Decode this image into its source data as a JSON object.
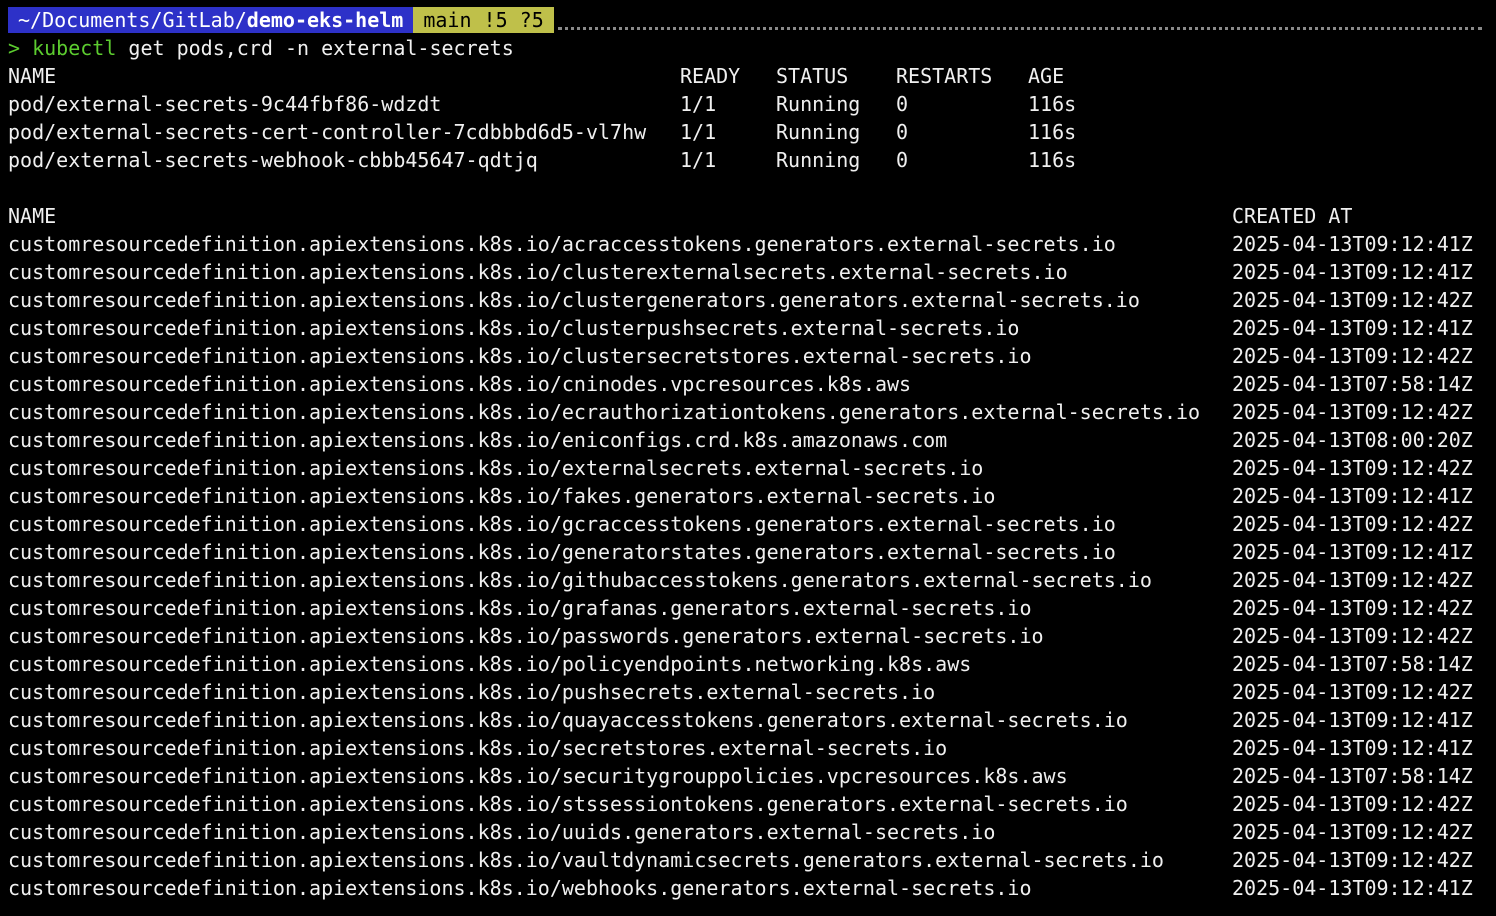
{
  "prompt": {
    "path_prefix": "~/Documents/GitLab/",
    "path_dir": "demo-eks-helm",
    "git_status": "main !5 ?5",
    "symbol": ">",
    "command_name": "kubectl",
    "command_args": " get pods,crd -n external-secrets"
  },
  "colors": {
    "background": "#000000",
    "path_segment": "#2d31c8",
    "git_segment": "#bfc04a",
    "prompt_green": "#5ccc2f",
    "text": "#f0f0f0"
  },
  "pods": {
    "headers": [
      "NAME",
      "READY",
      "STATUS",
      "RESTARTS",
      "AGE"
    ],
    "rows": [
      [
        "pod/external-secrets-9c44fbf86-wdzdt",
        "1/1",
        "Running",
        "0",
        "116s"
      ],
      [
        "pod/external-secrets-cert-controller-7cdbbbd6d5-vl7hw",
        "1/1",
        "Running",
        "0",
        "116s"
      ],
      [
        "pod/external-secrets-webhook-cbbb45647-qdtjq",
        "1/1",
        "Running",
        "0",
        "116s"
      ]
    ]
  },
  "crds": {
    "headers": [
      "NAME",
      "CREATED AT"
    ],
    "rows": [
      [
        "customresourcedefinition.apiextensions.k8s.io/acraccesstokens.generators.external-secrets.io",
        "2025-04-13T09:12:41Z"
      ],
      [
        "customresourcedefinition.apiextensions.k8s.io/clusterexternalsecrets.external-secrets.io",
        "2025-04-13T09:12:41Z"
      ],
      [
        "customresourcedefinition.apiextensions.k8s.io/clustergenerators.generators.external-secrets.io",
        "2025-04-13T09:12:42Z"
      ],
      [
        "customresourcedefinition.apiextensions.k8s.io/clusterpushsecrets.external-secrets.io",
        "2025-04-13T09:12:41Z"
      ],
      [
        "customresourcedefinition.apiextensions.k8s.io/clustersecretstores.external-secrets.io",
        "2025-04-13T09:12:42Z"
      ],
      [
        "customresourcedefinition.apiextensions.k8s.io/cninodes.vpcresources.k8s.aws",
        "2025-04-13T07:58:14Z"
      ],
      [
        "customresourcedefinition.apiextensions.k8s.io/ecrauthorizationtokens.generators.external-secrets.io",
        "2025-04-13T09:12:42Z"
      ],
      [
        "customresourcedefinition.apiextensions.k8s.io/eniconfigs.crd.k8s.amazonaws.com",
        "2025-04-13T08:00:20Z"
      ],
      [
        "customresourcedefinition.apiextensions.k8s.io/externalsecrets.external-secrets.io",
        "2025-04-13T09:12:42Z"
      ],
      [
        "customresourcedefinition.apiextensions.k8s.io/fakes.generators.external-secrets.io",
        "2025-04-13T09:12:41Z"
      ],
      [
        "customresourcedefinition.apiextensions.k8s.io/gcraccesstokens.generators.external-secrets.io",
        "2025-04-13T09:12:42Z"
      ],
      [
        "customresourcedefinition.apiextensions.k8s.io/generatorstates.generators.external-secrets.io",
        "2025-04-13T09:12:41Z"
      ],
      [
        "customresourcedefinition.apiextensions.k8s.io/githubaccesstokens.generators.external-secrets.io",
        "2025-04-13T09:12:42Z"
      ],
      [
        "customresourcedefinition.apiextensions.k8s.io/grafanas.generators.external-secrets.io",
        "2025-04-13T09:12:42Z"
      ],
      [
        "customresourcedefinition.apiextensions.k8s.io/passwords.generators.external-secrets.io",
        "2025-04-13T09:12:42Z"
      ],
      [
        "customresourcedefinition.apiextensions.k8s.io/policyendpoints.networking.k8s.aws",
        "2025-04-13T07:58:14Z"
      ],
      [
        "customresourcedefinition.apiextensions.k8s.io/pushsecrets.external-secrets.io",
        "2025-04-13T09:12:42Z"
      ],
      [
        "customresourcedefinition.apiextensions.k8s.io/quayaccesstokens.generators.external-secrets.io",
        "2025-04-13T09:12:41Z"
      ],
      [
        "customresourcedefinition.apiextensions.k8s.io/secretstores.external-secrets.io",
        "2025-04-13T09:12:41Z"
      ],
      [
        "customresourcedefinition.apiextensions.k8s.io/securitygrouppolicies.vpcresources.k8s.aws",
        "2025-04-13T07:58:14Z"
      ],
      [
        "customresourcedefinition.apiextensions.k8s.io/stssessiontokens.generators.external-secrets.io",
        "2025-04-13T09:12:42Z"
      ],
      [
        "customresourcedefinition.apiextensions.k8s.io/uuids.generators.external-secrets.io",
        "2025-04-13T09:12:42Z"
      ],
      [
        "customresourcedefinition.apiextensions.k8s.io/vaultdynamicsecrets.generators.external-secrets.io",
        "2025-04-13T09:12:42Z"
      ],
      [
        "customresourcedefinition.apiextensions.k8s.io/webhooks.generators.external-secrets.io",
        "2025-04-13T09:12:41Z"
      ]
    ]
  }
}
